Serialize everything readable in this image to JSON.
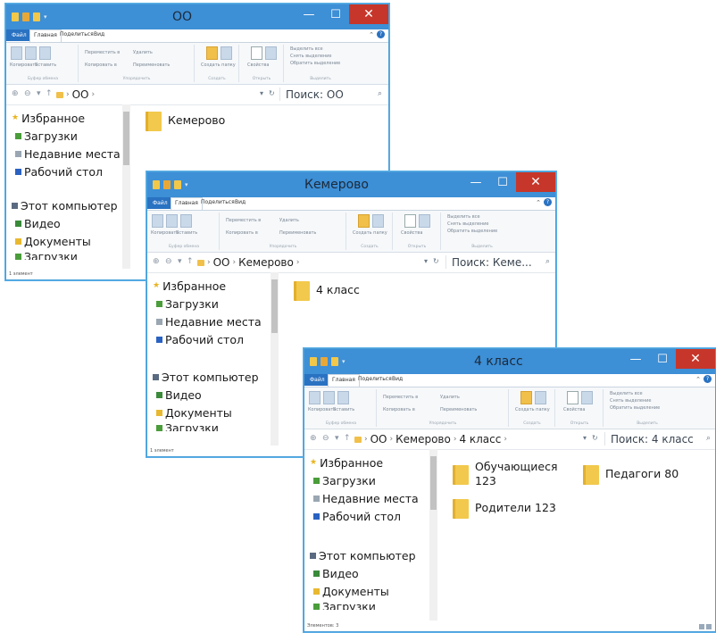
{
  "ribbon": {
    "tabs": [
      "Файл",
      "Главная",
      "Поделиться",
      "Вид"
    ],
    "copy": "Копировать",
    "paste": "Вставить",
    "move_to": "Переместить в",
    "copy_to": "Копировать в",
    "delete": "Удалить",
    "rename": "Переименовать",
    "new_folder": "Создать папку",
    "properties": "Свойства",
    "select_all": "Выделить все",
    "select_none": "Снять выделение",
    "invert_selection": "Обратить выделение",
    "group_clipboard": "Буфер обмена",
    "group_organize": "Упорядочить",
    "group_new": "Создать",
    "group_open": "Открыть",
    "group_select": "Выделить"
  },
  "nav": {
    "favorites": "Избранное",
    "downloads": "Загрузки",
    "recent": "Недавние места",
    "desktop": "Рабочий стол",
    "this_pc": "Этот компьютер",
    "videos": "Видео",
    "documents": "Документы",
    "cut": "Загрузки"
  },
  "window_controls": {
    "minimize": "—",
    "maximize": "☐",
    "close": "✕"
  },
  "windows": [
    {
      "title": "ОО",
      "path": [
        "ОО"
      ],
      "search": "Поиск: ОО",
      "items": [
        "Кемерово"
      ],
      "status": "1 элемент"
    },
    {
      "title": "Кемерово",
      "path": [
        "ОО",
        "Кемерово"
      ],
      "search": "Поиск: Кеме...",
      "items": [
        "4 класс"
      ],
      "status": "1 элемент"
    },
    {
      "title": "4 класс",
      "path": [
        "ОО",
        "Кемерово",
        "4 класс"
      ],
      "search": "Поиск: 4 класс",
      "items": [
        "Обучающиеся 123",
        "Педагоги 80",
        "Родители 123"
      ],
      "status": "Элементов: 3"
    }
  ],
  "colors": {
    "titlebar": "#3d8fd6",
    "close": "#c7362a",
    "folder": "#f2c94c",
    "file_tab": "#2a72c2"
  }
}
